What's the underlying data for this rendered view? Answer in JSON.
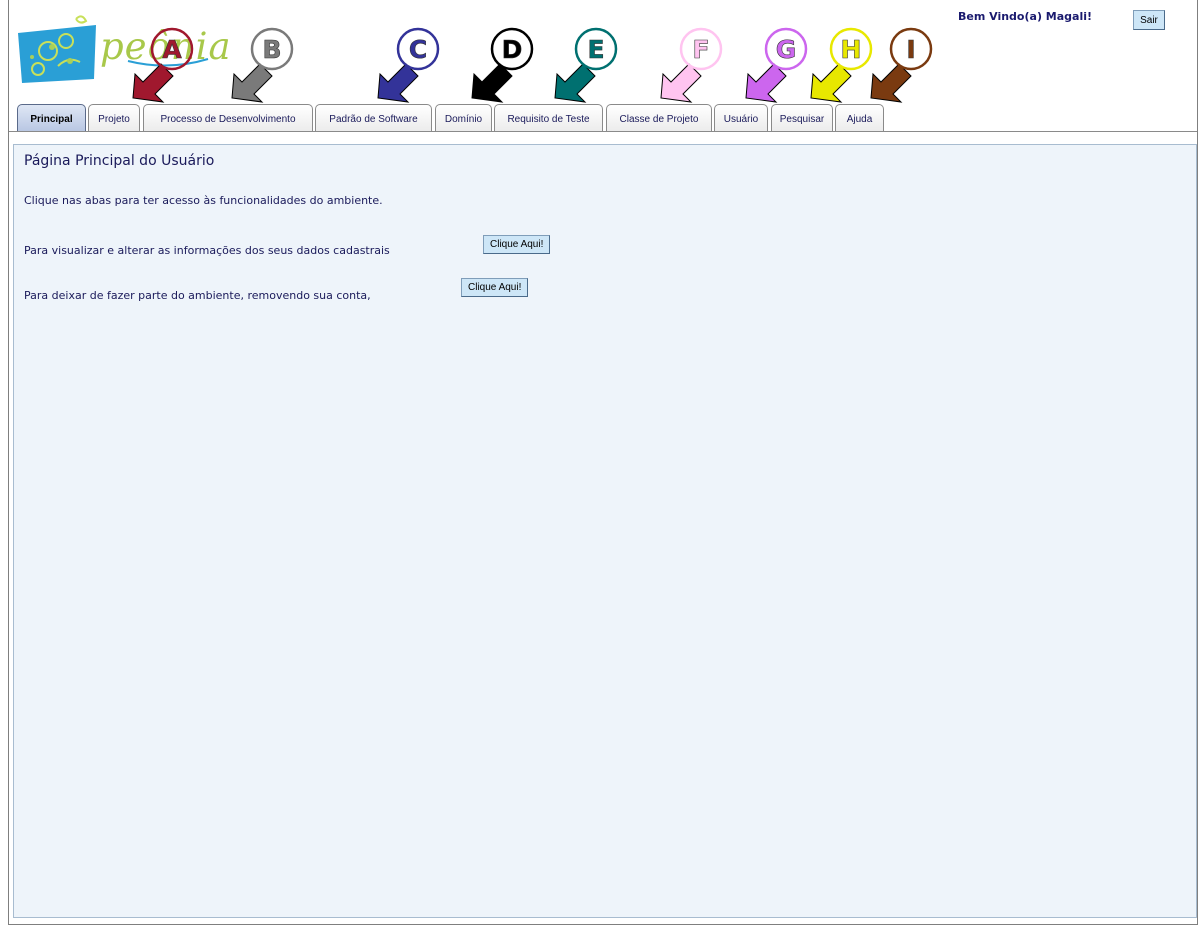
{
  "logo": {
    "text": "peônia"
  },
  "header": {
    "welcome": "Bem Vindo(a) Magali!",
    "logout_label": "Sair"
  },
  "markers": [
    {
      "letter": "A",
      "color": "#a0182e",
      "fill_circle": "#ffffff"
    },
    {
      "letter": "B",
      "color": "#7a7a7a",
      "fill_circle": "#ffffff"
    },
    {
      "letter": "C",
      "color": "#333399",
      "fill_circle": "#ffffff"
    },
    {
      "letter": "D",
      "color": "#000000",
      "fill_circle": "#ffffff"
    },
    {
      "letter": "E",
      "color": "#007070",
      "fill_circle": "#ffffff"
    },
    {
      "letter": "F",
      "color": "#ffc4f0",
      "fill_circle": "#ffffff"
    },
    {
      "letter": "G",
      "color": "#cc66ee",
      "fill_circle": "#ffffff"
    },
    {
      "letter": "H",
      "color": "#e8e800",
      "fill_circle": "#ffffff"
    },
    {
      "letter": "I",
      "color": "#7a3a10",
      "fill_circle": "#ffffff"
    }
  ],
  "tabs": [
    {
      "label": "Principal",
      "active": true
    },
    {
      "label": "Projeto"
    },
    {
      "label": "Processo de Desenvolvimento"
    },
    {
      "label": "Padrão de Software"
    },
    {
      "label": "Domínio"
    },
    {
      "label": "Requisito de Teste"
    },
    {
      "label": "Classe de Projeto"
    },
    {
      "label": "Usuário"
    },
    {
      "label": "Pesquisar"
    },
    {
      "label": "Ajuda"
    }
  ],
  "main": {
    "title": "Página Principal do Usuário",
    "intro": "Clique nas abas para ter acesso às funcionalidades do ambiente.",
    "line1": "Para visualizar e alterar as informações dos seus dados cadastrais",
    "line1_button": "Clique Aqui!",
    "line2": "Para deixar de fazer parte do ambiente, removendo sua conta,",
    "line2_button": "Clique Aqui!"
  }
}
